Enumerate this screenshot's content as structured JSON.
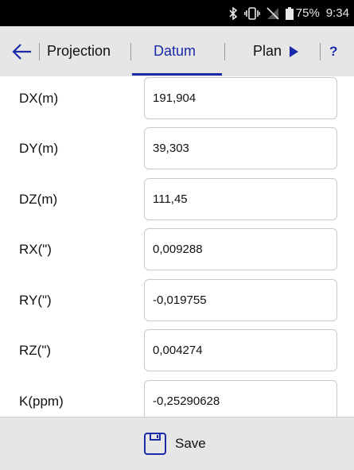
{
  "status_bar": {
    "icons": [
      "bluetooth-icon",
      "vibrate-icon",
      "no-signal-icon",
      "battery-icon"
    ],
    "battery": "75%",
    "time": "9:34"
  },
  "tabs": {
    "back_icon": "arrow-left-icon",
    "projection": "Projection",
    "datum": "Datum",
    "plan": "Plan",
    "plan_icon": "triangle-right-icon",
    "help": "?",
    "active": "Datum",
    "accent_color": "#1a2aa8"
  },
  "params": [
    {
      "label": "DX(m)",
      "value": "191,904"
    },
    {
      "label": "DY(m)",
      "value": "39,303"
    },
    {
      "label": "DZ(m)",
      "value": "111,45"
    },
    {
      "label": "RX(\")",
      "value": "0,009288"
    },
    {
      "label": "RY(\")",
      "value": "-0,019755"
    },
    {
      "label": "RZ(\")",
      "value": "0,004274"
    },
    {
      "label": "K(ppm)",
      "value": "-0,25290628"
    }
  ],
  "footer": {
    "save_icon": "save-icon",
    "save_label": "Save"
  }
}
